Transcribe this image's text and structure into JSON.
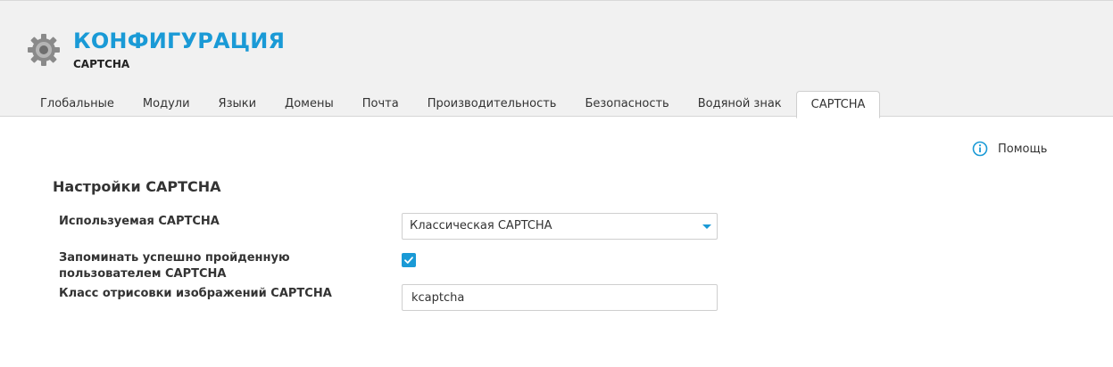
{
  "header": {
    "title": "КОНФИГУРАЦИЯ",
    "subtitle": "CAPTCHA",
    "icon": "gear-icon",
    "accent_color": "#1a9ad6"
  },
  "tabs": [
    {
      "label": "Глобальные",
      "active": false
    },
    {
      "label": "Модули",
      "active": false
    },
    {
      "label": "Языки",
      "active": false
    },
    {
      "label": "Домены",
      "active": false
    },
    {
      "label": "Почта",
      "active": false
    },
    {
      "label": "Производительность",
      "active": false
    },
    {
      "label": "Безопасность",
      "active": false
    },
    {
      "label": "Водяной знак",
      "active": false
    },
    {
      "label": "CAPTCHA",
      "active": true
    }
  ],
  "help": {
    "label": "Помощь",
    "icon": "info-icon"
  },
  "section": {
    "title": "Настройки CAPTCHA"
  },
  "form": {
    "captcha_type": {
      "label": "Используемая CAPTCHA",
      "value": "Классическая CAPTCHA"
    },
    "remember": {
      "label": "Запоминать успешно пройденную пользователем CAPTCHA",
      "checked": true
    },
    "render_class": {
      "label": "Класс отрисовки изображений CAPTCHA",
      "value": "kcaptcha"
    }
  }
}
